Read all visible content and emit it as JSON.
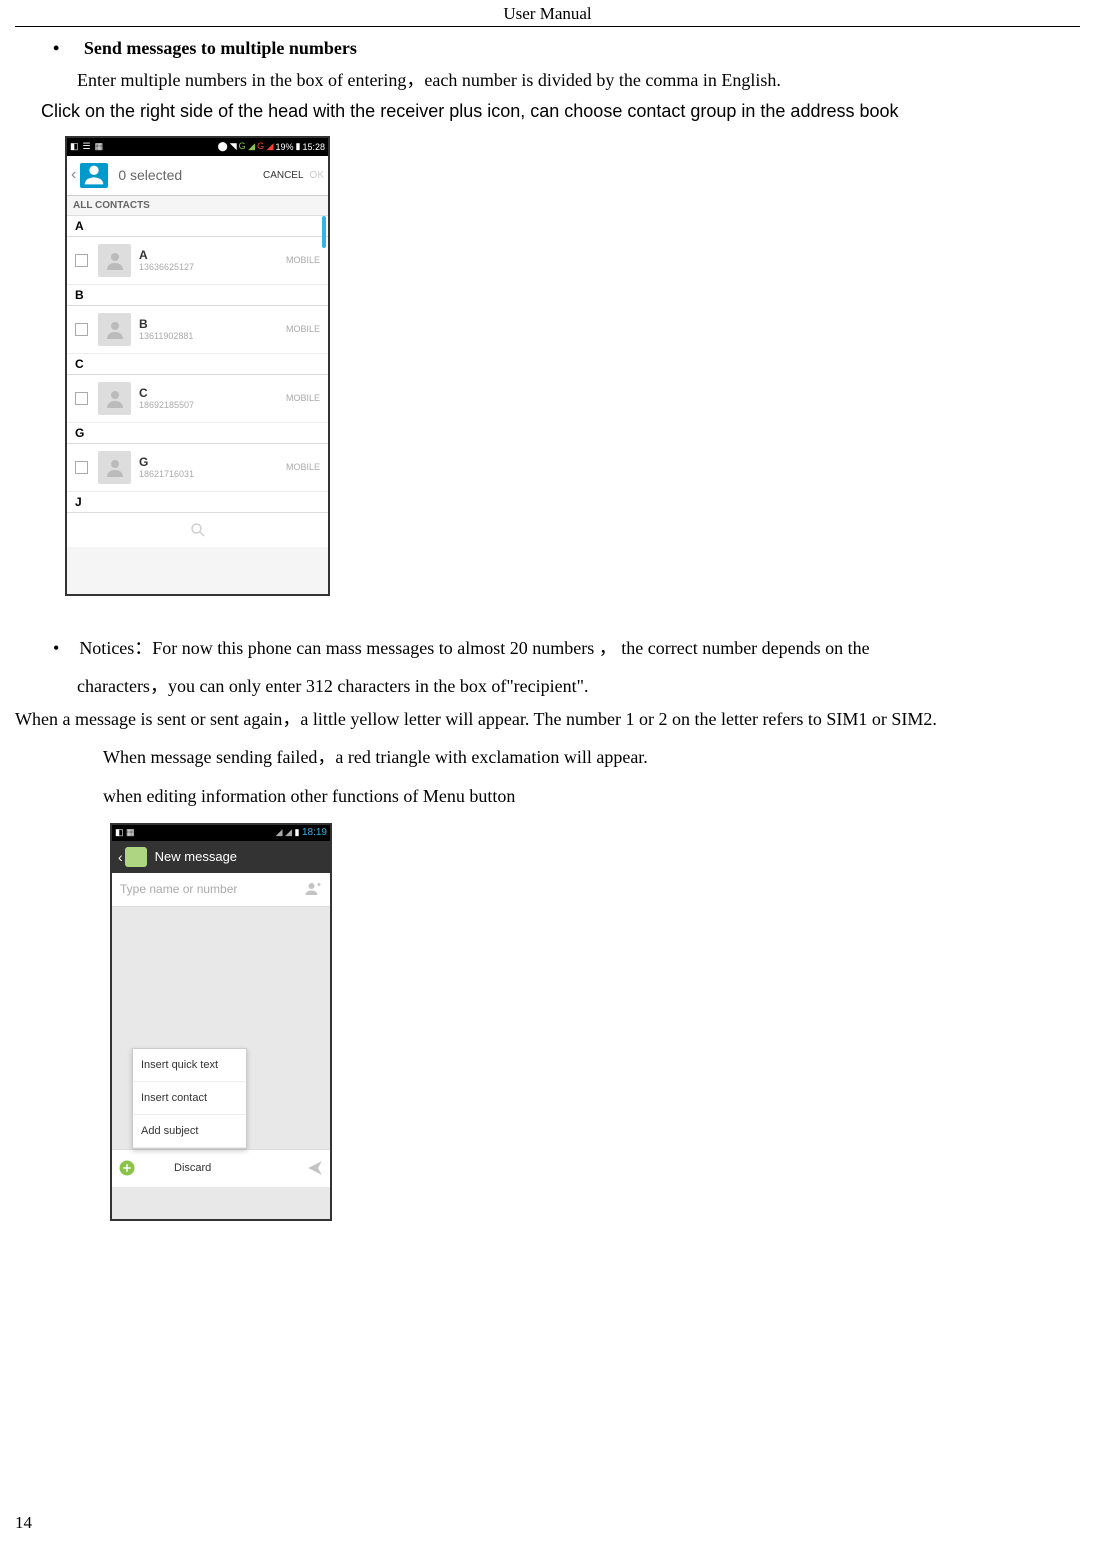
{
  "header": "User    Manual",
  "bullet1": "Send messages to multiple numbers",
  "para1": "Enter multiple numbers in the box of entering，each number is divided by the comma in English.",
  "para2": "Click on the right side of the head with the receiver plus icon, can choose contact group in the address book",
  "screenshot1": {
    "status_time": "15:28",
    "status_battery": "19%",
    "selected": "0 selected",
    "cancel": "CANCEL",
    "ok": "OK",
    "all_contacts": "ALL CONTACTS",
    "sections": [
      {
        "letter": "A",
        "contacts": [
          {
            "name": "A",
            "number": "13636625127",
            "type": "MOBILE"
          }
        ]
      },
      {
        "letter": "B",
        "contacts": [
          {
            "name": "B",
            "number": "13611902881",
            "type": "MOBILE"
          }
        ]
      },
      {
        "letter": "C",
        "contacts": [
          {
            "name": "C",
            "number": "18692185507",
            "type": "MOBILE"
          }
        ]
      },
      {
        "letter": "G",
        "contacts": [
          {
            "name": "G",
            "number": "18621716031",
            "type": "MOBILE"
          }
        ]
      }
    ],
    "last_letter": "J"
  },
  "notices_label": "Notices：",
  "notices_text1": "For now this phone can mass messages to almost 20 numbers ， the correct number depends on the",
  "notices_text2": "characters，you can only enter 312 characters in the box of\"recipient\".",
  "para3": "When a message is sent or sent again，a little yellow letter will appear. The number 1 or 2 on the letter refers to SIM1 or SIM2.",
  "para4": "When message sending failed，a red triangle with exclamation will appear.",
  "para5": "when editing information other functions of Menu button",
  "screenshot2": {
    "status_time": "18:19",
    "title": "New message",
    "placeholder": "Type name or number",
    "menu": [
      "Insert quick text",
      "Insert contact",
      "Add subject",
      "Discard"
    ]
  },
  "page_number": "14"
}
